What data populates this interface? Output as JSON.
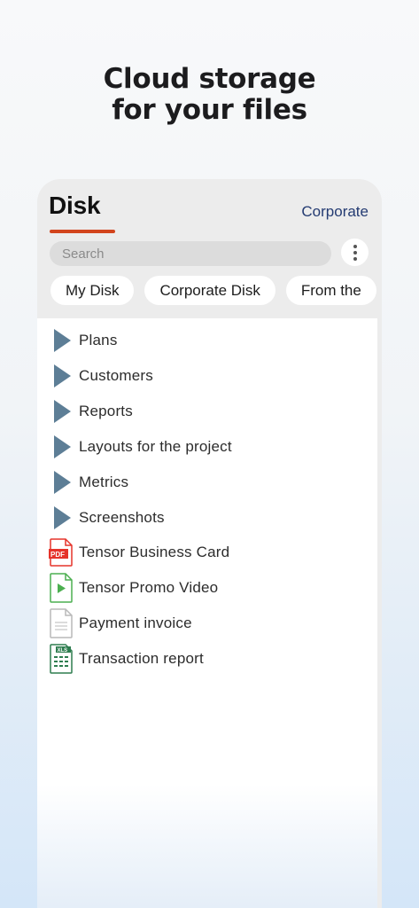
{
  "promo": {
    "line1": "Cloud storage",
    "line2": "for your files"
  },
  "header": {
    "title": "Disk",
    "link": "Corporate"
  },
  "search": {
    "placeholder": "Search"
  },
  "tabs": [
    "My Disk",
    "Corporate Disk",
    "From the"
  ],
  "items": [
    {
      "label": "Plans",
      "kind": "folder",
      "icon": "folder-icon"
    },
    {
      "label": "Customers",
      "kind": "folder",
      "icon": "folder-icon"
    },
    {
      "label": "Reports",
      "kind": "folder",
      "icon": "folder-icon"
    },
    {
      "label": "Layouts for the project",
      "kind": "folder",
      "icon": "folder-icon"
    },
    {
      "label": "Metrics",
      "kind": "folder",
      "icon": "folder-icon"
    },
    {
      "label": "Screenshots",
      "kind": "folder",
      "icon": "folder-icon"
    },
    {
      "label": "Tensor Business Card",
      "kind": "pdf",
      "icon": "pdf-file-icon",
      "badge": "PDF"
    },
    {
      "label": "Tensor Promo Video",
      "kind": "video",
      "icon": "video-file-icon"
    },
    {
      "label": "Payment invoice",
      "kind": "doc",
      "icon": "document-file-icon"
    },
    {
      "label": "Transaction report",
      "kind": "xls",
      "icon": "spreadsheet-file-icon",
      "badge": "XLS"
    }
  ],
  "colors": {
    "accent": "#d2441c",
    "link": "#243b72",
    "folder": "#5d7e96",
    "pdf": "#e5332a",
    "video": "#4caf50",
    "xls": "#2e7d4f"
  }
}
